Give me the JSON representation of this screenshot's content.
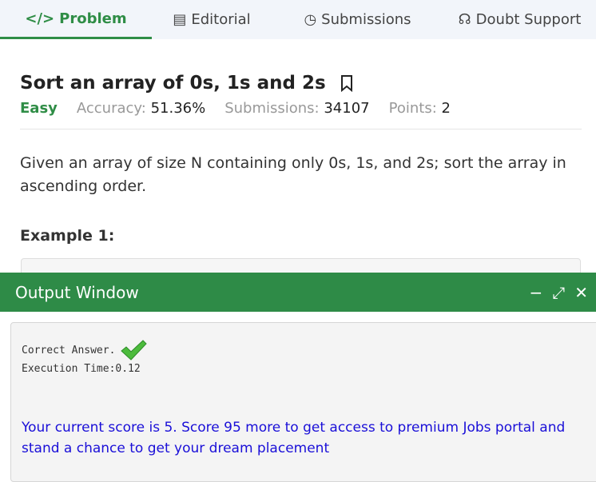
{
  "tabs": [
    {
      "label": "Problem",
      "icon": "code-icon"
    },
    {
      "label": "Editorial",
      "icon": "document-icon"
    },
    {
      "label": "Submissions",
      "icon": "clock-icon"
    },
    {
      "label": "Doubt Support",
      "icon": "headset-icon"
    }
  ],
  "problem": {
    "title": "Sort an array of 0s, 1s and 2s",
    "difficulty": "Easy",
    "accuracy_label": "Accuracy:",
    "accuracy": "51.36%",
    "submissions_label": "Submissions:",
    "submissions": "34107",
    "points_label": "Points:",
    "points": "2",
    "description": "Given an array of size N containing only 0s, 1s, and 2s; sort the array in ascending order.",
    "example_heading": "Example 1:"
  },
  "output": {
    "title": "Output Window",
    "result": "Correct Answer.",
    "exec_time": "Execution Time:0.12",
    "score_msg": "Your current score is 5. Score 95 more to get access to premium Jobs portal and stand a chance to get your dream placement"
  },
  "colors": {
    "brand": "#2e8b47",
    "link": "#1a0fd8"
  }
}
